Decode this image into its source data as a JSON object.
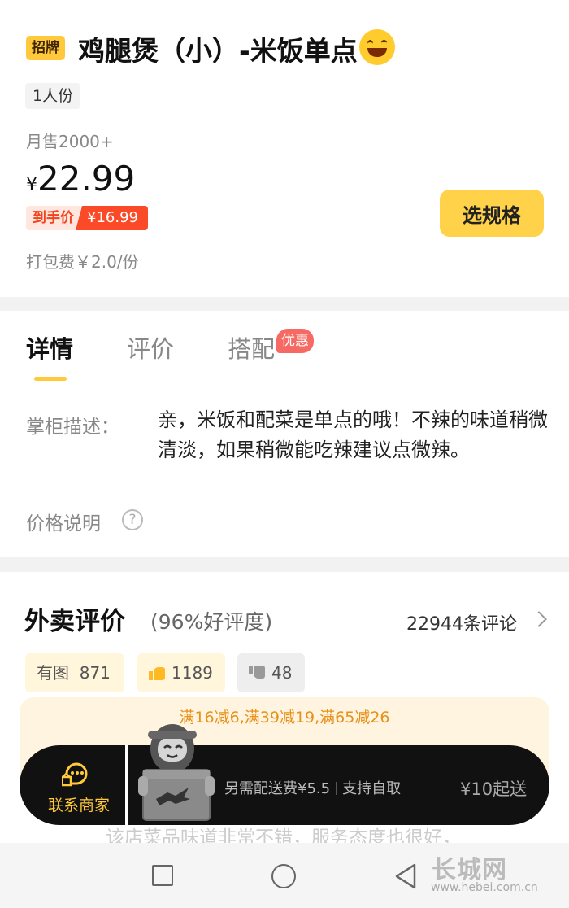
{
  "product": {
    "sign_badge": "招牌",
    "title": "鸡腿煲（小）-米饭单点",
    "portion_tag": "1人份",
    "monthly_sales": "月售2000+",
    "currency_symbol": "¥",
    "price": "22.99",
    "final_price_label": "到手价",
    "final_price": "¥16.99",
    "packing_fee": "打包费￥2.0/份",
    "select_spec_button": "选规格"
  },
  "tabs": [
    {
      "label": "详情",
      "active": true
    },
    {
      "label": "评价",
      "active": false
    },
    {
      "label": "搭配",
      "active": false,
      "badge": "优惠"
    }
  ],
  "details": {
    "description_label": "掌柜描述：",
    "description_text": "亲，米饭和配菜是单点的哦！不辣的味道稍微清淡，如果稍微能吃辣建议点微辣。",
    "price_note_label": "价格说明",
    "help_glyph": "?"
  },
  "reviews": {
    "title": "外卖评价",
    "rating_text": "(96%好评度)",
    "count_text": "22944条评论",
    "filters": [
      {
        "label": "有图",
        "count": "871"
      },
      {
        "label": "",
        "count": "1189",
        "icon": "thumbs-up-icon"
      },
      {
        "label": "",
        "count": "48",
        "icon": "thumbs-down-icon"
      }
    ],
    "preview_text": "该店菜品味道非常不错，服务态度也很好，"
  },
  "promotion": {
    "discount_text": "满16减6,满39减19,满65减26"
  },
  "cart_bar": {
    "contact_label": "联系商家",
    "delivery_fee": "另需配送费¥5.5",
    "self_pickup": "支持自取",
    "min_order": "¥10起送"
  },
  "watermark": {
    "brand": "长城网",
    "url": "www.hebei.com.cn"
  },
  "colors": {
    "accent_yellow": "#ffd24a",
    "deal_red": "#fa4a27",
    "promo_orange": "#e89019"
  }
}
